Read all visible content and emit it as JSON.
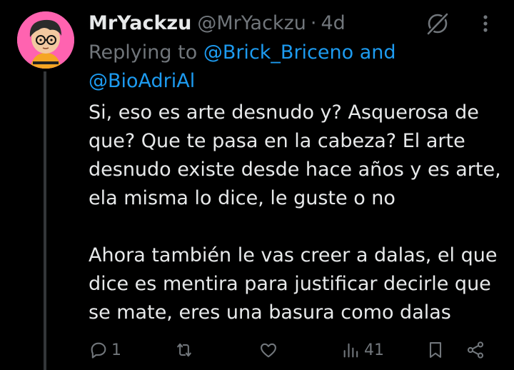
{
  "tweet": {
    "display_name": "MrYackzu",
    "handle": "@MrYackzu",
    "separator": "·",
    "time": "4d",
    "replying_prefix": "Replying to",
    "reply_mention_1": "@Brick_Briceno",
    "reply_conjunction": "and",
    "reply_mention_2": "@BioAdriAl",
    "paragraphs": [
      "Si, eso es arte desnudo y?  Asquerosa de que? Que te pasa en la cabeza? El arte desnudo existe desde hace años y es arte, ela misma lo dice, le guste o no",
      "Ahora también le vas creer a dalas, el que dice es mentira para justificar decirle que se mate, eres una basura como dalas"
    ]
  },
  "actions": {
    "reply_count": "1",
    "views_count": "41"
  },
  "icons": {
    "avatar": "cartoon-avatar",
    "grok": "grok-icon",
    "more": "more-vertical-icon",
    "reply": "reply-bubble-icon",
    "retweet": "retweet-icon",
    "like": "heart-icon",
    "views": "views-bars-icon",
    "bookmark": "bookmark-icon",
    "share": "share-icon"
  },
  "colors": {
    "background": "#000000",
    "text_primary": "#e7e9ea",
    "text_secondary": "#71767b",
    "accent": "#1d9bf0",
    "avatar_bg": "#ff63b0"
  }
}
